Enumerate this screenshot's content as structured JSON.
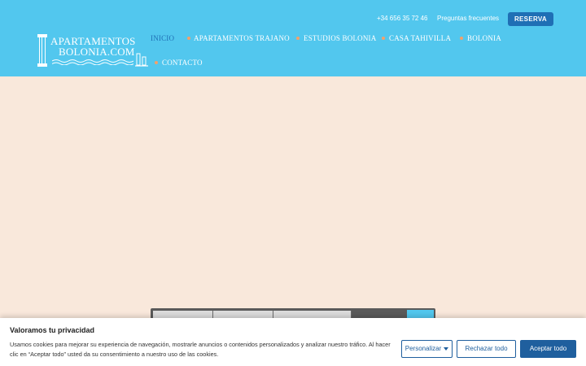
{
  "header": {
    "phone": "+34 656 35 72 46",
    "faq_label": "Preguntas frecuentes",
    "reserva_label": "RESERVA",
    "logo": {
      "line1": "APARTAMENTOS",
      "line2": "BOLONIA.COM"
    }
  },
  "nav": {
    "items": [
      {
        "label": "INICIO",
        "active": true
      },
      {
        "label": "APARTAMENTOS TRAJANO",
        "active": false
      },
      {
        "label": "ESTUDIOS BOLONIA",
        "active": false
      },
      {
        "label": "CASA TAHIVILLA",
        "active": false
      },
      {
        "label": "BOLONIA",
        "active": false
      },
      {
        "label": "CONTACTO",
        "active": false
      }
    ]
  },
  "colors": {
    "header_bg": "#52c7ee",
    "page_bg": "#f9e8db",
    "accent": "#1f6fb5",
    "nav_dot": "#f4a06a"
  },
  "cookie_banner": {
    "title": "Valoramos tu privacidad",
    "text": "Usamos cookies para mejorar su experiencia de navegación, mostrarle anuncios o contenidos personalizados y analizar nuestro tráfico. Al hacer clic en “Aceptar todo” usted da su consentimiento a nuestro uso de las cookies.",
    "customize_label": "Personalizar",
    "reject_label": "Rechazar todo",
    "accept_label": "Aceptar todo"
  }
}
